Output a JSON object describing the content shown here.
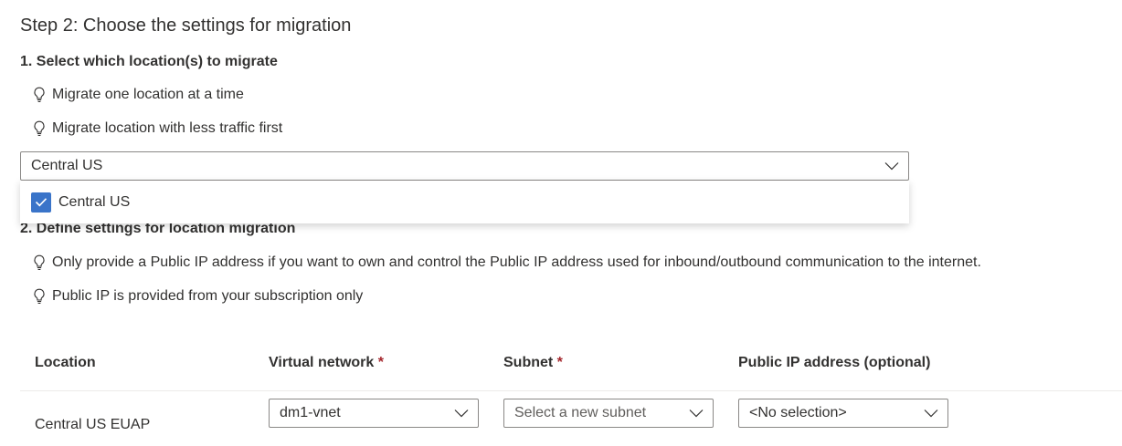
{
  "step_title": "Step 2: Choose the settings for migration",
  "section1": {
    "title": "1. Select which location(s) to migrate",
    "tips": [
      "Migrate one location at a time",
      "Migrate location with less traffic first"
    ],
    "location_dropdown": {
      "selected": "Central US",
      "options": [
        {
          "label": "Central US",
          "checked": true
        }
      ]
    }
  },
  "section2": {
    "title": "2. Define settings for location migration",
    "tips": [
      "Only provide a Public IP address if you want to own and control the Public IP address used for inbound/outbound communication to the internet.",
      "Public IP is provided from your subscription only"
    ]
  },
  "table": {
    "headers": {
      "location": "Location",
      "virtual_network": "Virtual network",
      "subnet": "Subnet",
      "public_ip": "Public IP address (optional)",
      "required_marker": "*"
    },
    "rows": [
      {
        "location": "Central US EUAP",
        "virtual_network": "dm1-vnet",
        "subnet_placeholder": "Select a new subnet",
        "public_ip": "<No selection>"
      }
    ]
  },
  "colors": {
    "checkbox_accent": "#3a74c9",
    "required": "#a4262c",
    "text": "#323130",
    "border": "#8a8886"
  },
  "icons": [
    "lightbulb-icon",
    "chevron-down-icon",
    "checkmark-icon"
  ]
}
